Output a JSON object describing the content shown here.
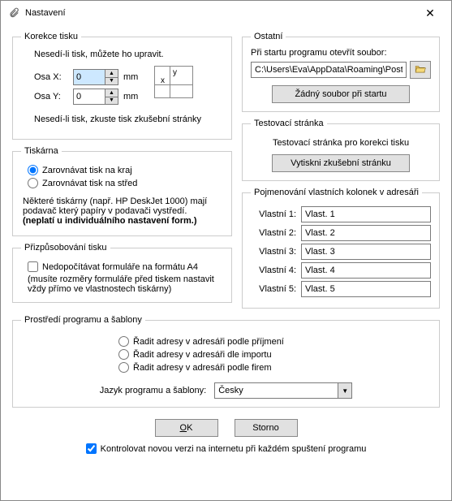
{
  "window": {
    "title": "Nastavení"
  },
  "korekce": {
    "legend": "Korekce tisku",
    "note_top": "Nesedí-li tisk, můžete ho upravit.",
    "osa_x_label": "Osa X:",
    "osa_x_value": "0",
    "osa_y_label": "Osa Y:",
    "osa_y_value": "0",
    "unit": "mm",
    "diagram_y": "y",
    "diagram_x": "x",
    "note_bottom": "Nesedí-li tisk, zkuste tisk zkušební stránky"
  },
  "tiskarna": {
    "legend": "Tiskárna",
    "radio_edge": "Zarovnávat tisk na kraj",
    "radio_center": "Zarovnávat tisk na střed",
    "note_line1": "Některé tiskárny (např. HP DeskJet 1000) mají",
    "note_line2": "podavač který papíry v podavači vystředí.",
    "note_line3": "(neplatí u individuálního nastavení form.)"
  },
  "prizp": {
    "legend": "Přizpůsobování tisku",
    "check_label": "Nedopočítávat formuláře na formátu A4",
    "note_line1": "(musíte rozměry formuláře před tiskem nastavit",
    "note_line2": "vždy přímo ve vlastnostech tiskárny)"
  },
  "ostatni": {
    "legend": "Ostatní",
    "open_label": "Při startu programu otevřít soubor:",
    "path_value": "C:\\Users\\Eva\\AppData\\Roaming\\Post",
    "no_file_btn": "Žádný soubor při startu"
  },
  "test": {
    "legend": "Testovací stránka",
    "note": "Testovací stránka pro korekci tisku",
    "print_btn": "Vytiskni zkušební stránku"
  },
  "columns": {
    "legend": "Pojmenování vlastních kolonek v adresáři",
    "items": [
      {
        "label": "Vlastní 1:",
        "value": "Vlast. 1"
      },
      {
        "label": "Vlastní 2:",
        "value": "Vlast. 2"
      },
      {
        "label": "Vlastní 3:",
        "value": "Vlast. 3"
      },
      {
        "label": "Vlastní 4:",
        "value": "Vlast. 4"
      },
      {
        "label": "Vlastní 5:",
        "value": "Vlast. 5"
      }
    ]
  },
  "prostredi": {
    "legend": "Prostředí programu a šablony",
    "sort_surname": "Řadit adresy v adresáři podle příjmení",
    "sort_import": "Řadit adresy v adresáři dle importu",
    "sort_company": "Řadit adresy v adresáři podle firem",
    "lang_label": "Jazyk programu a šablony:",
    "lang_value": "Česky"
  },
  "buttons": {
    "ok_pre": "",
    "ok_u": "O",
    "ok_post": "K",
    "cancel": "Storno"
  },
  "bottom": {
    "check_label": "Kontrolovat novou verzi na internetu při každém spuštení programu"
  }
}
